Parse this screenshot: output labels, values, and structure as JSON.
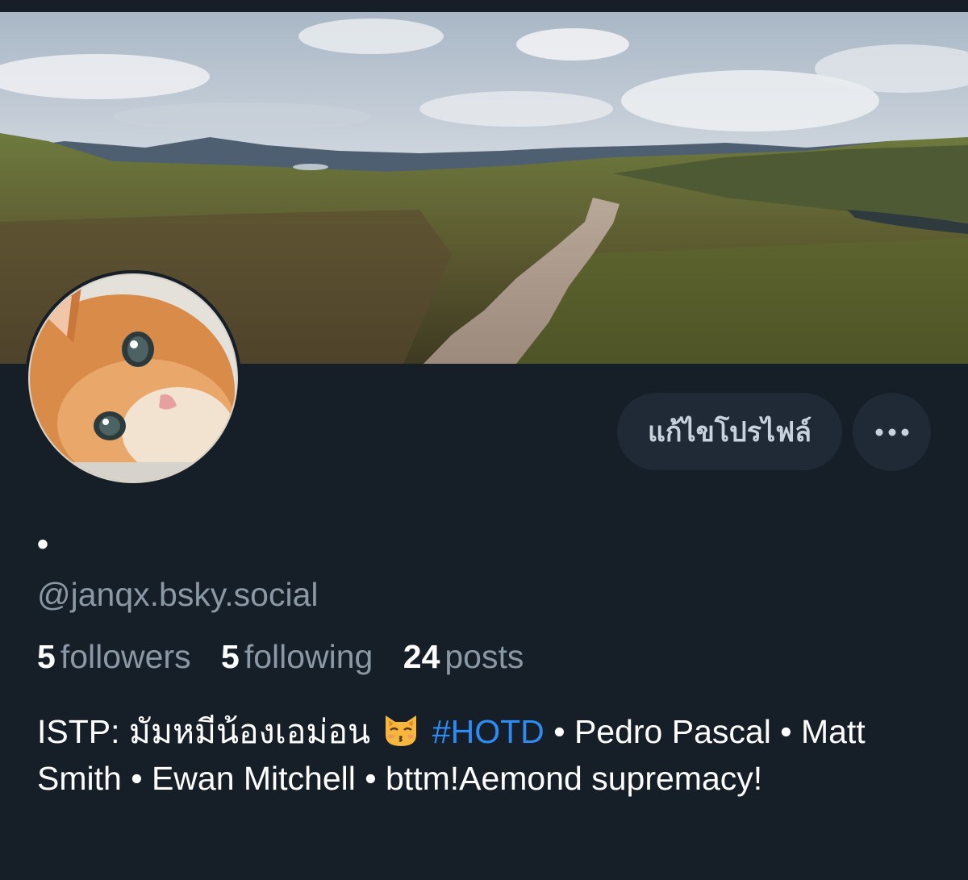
{
  "profile": {
    "display_name": "•",
    "handle": "@janqx.bsky.social",
    "edit_label": "แก้ไขโปรไฟล์",
    "more_icon": "more-horizontal-icon",
    "banner_image": "highland-landscape-banner",
    "avatar_image": "ginger-cat-avatar"
  },
  "stats": {
    "followers_count": "5",
    "followers_label": "followers",
    "following_count": "5",
    "following_label": "following",
    "posts_count": "24",
    "posts_label": "posts"
  },
  "bio": {
    "part1": "ISTP: มัมหมีน้องเอม่อน",
    "emoji": "kissing-cat-emoji",
    "hashtag": "#HOTD",
    "part2": "• Pedro Pascal • Matt Smith • Ewan Mitchell • bttm!Aemond supremacy!"
  },
  "colors": {
    "background": "#161e27",
    "button_bg": "#1f2a36",
    "muted_text": "#8b98a5",
    "link": "#2c8cf4"
  }
}
